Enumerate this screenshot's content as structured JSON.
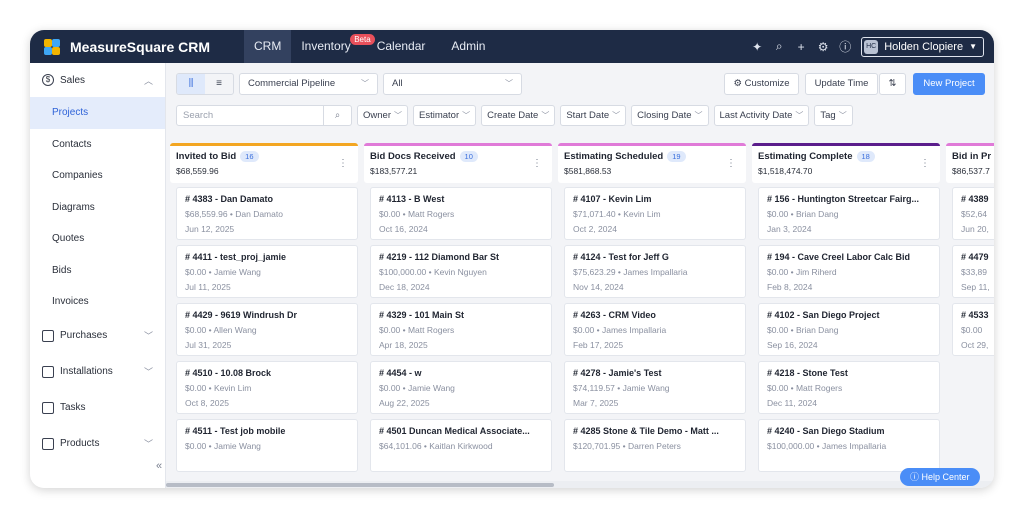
{
  "app": {
    "name": "MeasureSquare CRM"
  },
  "nav": [
    {
      "label": "CRM",
      "active": true
    },
    {
      "label": "Inventory",
      "badge": "Beta"
    },
    {
      "label": "Calendar"
    },
    {
      "label": "Admin"
    }
  ],
  "user": {
    "initials": "HC",
    "name": "Holden Clopiere"
  },
  "icons": [
    "sparkle-icon",
    "search-icon",
    "plus-icon",
    "gear-icon",
    "help-icon"
  ],
  "sidebar": {
    "groups": [
      {
        "label": "Sales",
        "items": [
          "Projects",
          "Contacts",
          "Companies",
          "Diagrams",
          "Quotes",
          "Bids",
          "Invoices"
        ]
      },
      {
        "label": "Purchases"
      },
      {
        "label": "Installations"
      },
      {
        "label": "Tasks"
      },
      {
        "label": "Products"
      }
    ],
    "active": "Projects"
  },
  "toolbar": {
    "view_board": "⫼",
    "view_list": "≡",
    "pipeline": "Commercial Pipeline",
    "status": "All",
    "customize": "Customize",
    "update_time": "Update Time",
    "sort": "⇅",
    "new_project": "New Project"
  },
  "filters": {
    "search_placeholder": "Search",
    "chips": [
      "Owner",
      "Estimator",
      "Create Date",
      "Start Date",
      "Closing Date",
      "Last Activity Date",
      "Tag"
    ]
  },
  "colors": {
    "accent": "#4a8df7",
    "topbar": "#1e2b45",
    "col_invited": "#f3a622",
    "col_bid_docs": "#e07ad8",
    "col_estimating": "#e07ad8",
    "col_complete": "#5b1d8c",
    "col_bid_in": "#e07ad8"
  },
  "columns": [
    {
      "name": "Invited to Bid",
      "count": "16",
      "amount": "$68,559.96",
      "color": "#f3a622",
      "cards": [
        {
          "title": "# 4383 - Dan Damato",
          "meta": "$68,559.96 • Dan Damato",
          "date": "Jun 12, 2025"
        },
        {
          "title": "# 4411 - test_proj_jamie",
          "meta": "$0.00 • Jamie Wang",
          "date": "Jul 11, 2025"
        },
        {
          "title": "# 4429 - 9619 Windrush Dr",
          "meta": "$0.00 • Allen Wang",
          "date": "Jul 31, 2025"
        },
        {
          "title": "# 4510 - 10.08 Brock",
          "meta": "$0.00 • Kevin Lim",
          "date": "Oct 8, 2025"
        },
        {
          "title": "# 4511 - Test job mobile",
          "meta": "$0.00 • Jamie Wang",
          "date": ""
        }
      ]
    },
    {
      "name": "Bid Docs Received",
      "count": "10",
      "amount": "$183,577.21",
      "color": "#e07ad8",
      "cards": [
        {
          "title": "# 4113 - B West",
          "meta": "$0.00 • Matt Rogers",
          "date": "Oct 16, 2024"
        },
        {
          "title": "# 4219 - 112 Diamond Bar St",
          "meta": "$100,000.00 • Kevin Nguyen",
          "date": "Dec 18, 2024"
        },
        {
          "title": "# 4329 - 101 Main St",
          "meta": "$0.00 • Matt Rogers",
          "date": "Apr 18, 2025"
        },
        {
          "title": "# 4454 - w",
          "meta": "$0.00 • Jamie Wang",
          "date": "Aug 22, 2025"
        },
        {
          "title": "# 4501 Duncan Medical Associate...",
          "meta": "$64,101.06 • Kaitlan Kirkwood",
          "date": ""
        }
      ]
    },
    {
      "name": "Estimating Scheduled",
      "count": "19",
      "amount": "$581,868.53",
      "color": "#e07ad8",
      "cards": [
        {
          "title": "# 4107 - Kevin Lim",
          "meta": "$71,071.40 • Kevin Lim",
          "date": "Oct 2, 2024"
        },
        {
          "title": "# 4124 - Test for Jeff G",
          "meta": "$75,623.29 • James Impallaria",
          "date": "Nov 14, 2024"
        },
        {
          "title": "# 4263 - CRM Video",
          "meta": "$0.00 • James Impallaria",
          "date": "Feb 17, 2025"
        },
        {
          "title": "# 4278 - Jamie's Test",
          "meta": "$74,119.57 • Jamie Wang",
          "date": "Mar 7, 2025"
        },
        {
          "title": "# 4285 Stone & Tile Demo - Matt ...",
          "meta": "$120,701.95 • Darren Peters",
          "date": ""
        }
      ]
    },
    {
      "name": "Estimating Complete",
      "count": "18",
      "amount": "$1,518,474.70",
      "color": "#5b1d8c",
      "cards": [
        {
          "title": "# 156 - Huntington Streetcar Fairg...",
          "meta": "$0.00 • Brian Dang",
          "date": "Jan 3, 2024"
        },
        {
          "title": "# 194 - Cave Creel Labor Calc Bid",
          "meta": "$0.00 • Jim Riherd",
          "date": "Feb 8, 2024"
        },
        {
          "title": "# 4102 - San Diego Project",
          "meta": "$0.00 • Brian Dang",
          "date": "Sep 16, 2024"
        },
        {
          "title": "# 4218 - Stone Test",
          "meta": "$0.00 • Matt Rogers",
          "date": "Dec 11, 2024"
        },
        {
          "title": "# 4240 - San Diego Stadium",
          "meta": "$100,000.00 • James Impallaria",
          "date": ""
        }
      ]
    },
    {
      "name": "Bid in Pr",
      "count": "",
      "amount": "$86,537.7",
      "color": "#e07ad8",
      "cards": [
        {
          "title": "# 4389",
          "meta": "$52,64",
          "date": "Jun 20,"
        },
        {
          "title": "# 4479",
          "meta": "$33,89",
          "date": "Sep 11,"
        },
        {
          "title": "# 4533",
          "meta": "$0.00",
          "date": "Oct 29,"
        }
      ]
    }
  ],
  "help": {
    "label": "Help Center"
  },
  "collapse": "«"
}
